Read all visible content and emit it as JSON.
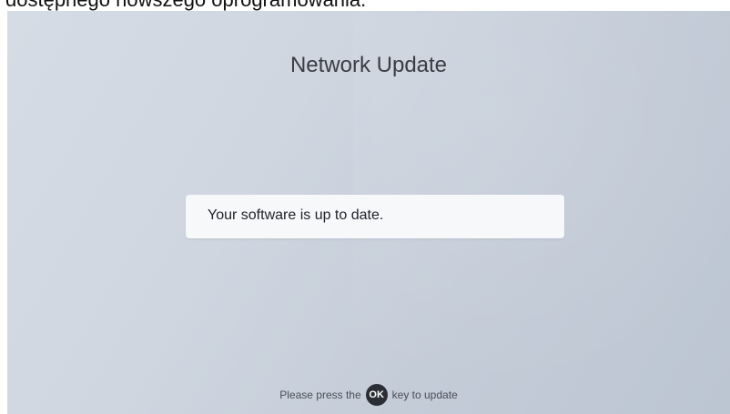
{
  "caption": "dostępnego nowszego oprogramowania.",
  "screen": {
    "title": "Network Update",
    "message": "Your software is up to date.",
    "hint": {
      "before": "Please press the",
      "key": "OK",
      "after": "key to update"
    }
  }
}
